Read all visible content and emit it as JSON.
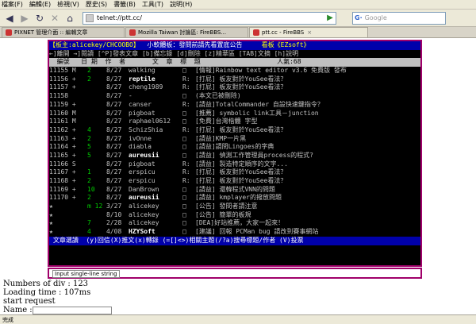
{
  "menubar": [
    "檔案(F)",
    "編輯(E)",
    "檢視(V)",
    "歷史(S)",
    "書籤(B)",
    "工具(T)",
    "說明(H)"
  ],
  "navbar": {
    "url": "telnet://ptt.cc/",
    "search_placeholder": "Google"
  },
  "tabs": [
    {
      "label": "PIXNET 管理介面 :: 編輯文章",
      "active": false
    },
    {
      "label": "Mozilla Taiwan 討論區: FireBBS...",
      "active": false
    },
    {
      "label": "ptt.cc - FireBBS",
      "active": true
    }
  ],
  "terminal": {
    "header1": {
      "left": "【板主:alicekey/CHCOOBO】",
      "mid": "小軟體板：發問前請先看置底公告",
      "right": "看板《EZsoft》"
    },
    "header2": "←]離開 →]閱讀 [^P]發表文章 [b]備忘錄 [d]刪除 [z]精華區 [TAB]文摘 [h]說明",
    "header3": "  編號   日 期  作  者       文  章  標  題                    人氣:68",
    "rows": [
      {
        "num": "11155 M",
        "mark": "2",
        "date": "8/27",
        "author": "walking",
        "bold": false,
        "tag": "□",
        "title": "[情報]Rainbow text editor v3.6 免費版 發布"
      },
      {
        "num": "11156 +",
        "mark": "2",
        "date": "8/27",
        "author": "reptile",
        "bold": true,
        "tag": "R:",
        "title": "[打屁] 板友對於YouSee看法？"
      },
      {
        "num": "11157 +",
        "mark": "",
        "date": "8/27",
        "author": "cheng1989",
        "bold": false,
        "tag": "R:",
        "title": "[打屁] 板友對於YouSee看法？"
      },
      {
        "num": "11158",
        "mark": "",
        "date": "8/27",
        "author": "-",
        "bold": false,
        "tag": "□",
        "title": "(本文已被刪除)"
      },
      {
        "num": "11159 +",
        "mark": "",
        "date": "8/27",
        "author": "canser",
        "bold": false,
        "tag": "R:",
        "title": "[請益]TotalCommander 自設快速鍵指令？"
      },
      {
        "num": "11160 M",
        "mark": "",
        "date": "8/27",
        "author": "pigboat",
        "bold": false,
        "tag": "□",
        "title": "[推薦] symbolic link工具－junction"
      },
      {
        "num": "11161 M",
        "mark": "",
        "date": "8/27",
        "author": "raphael0612",
        "bold": false,
        "tag": "□",
        "title": "[免費]台灣楷體 字型"
      },
      {
        "num": "11162 +",
        "mark": "4",
        "date": "8/27",
        "author": "SchizShia",
        "bold": false,
        "tag": "R:",
        "title": "[打屁] 板友對於YouSee看法？"
      },
      {
        "num": "11163 +",
        "mark": "2",
        "date": "8/27",
        "author": "ivOnne",
        "bold": false,
        "tag": "□",
        "title": "[請益]KMP一片黑"
      },
      {
        "num": "11164 +",
        "mark": "5",
        "date": "8/27",
        "author": "diabla",
        "bold": false,
        "tag": "□",
        "title": "[請益]請問Lingoes的字典"
      },
      {
        "num": "11165 +",
        "mark": "5",
        "date": "8/27",
        "author": "aureusii",
        "bold": true,
        "tag": "□",
        "title": "[請益] 偵測工作管理員process的程式?"
      },
      {
        "num": "11166 S",
        "mark": "",
        "date": "8/27",
        "author": "pigboat",
        "bold": false,
        "tag": "R:",
        "title": "[請益] 製造特定順序的文字..."
      },
      {
        "num": "11167 +",
        "mark": "1",
        "date": "8/27",
        "author": "erspicu",
        "bold": false,
        "tag": "R:",
        "title": "[打屁] 板友對於YouSee看法？"
      },
      {
        "num": "11168 +",
        "mark": "2",
        "date": "8/27",
        "author": "erspicu",
        "bold": false,
        "tag": "R:",
        "title": "[打屁] 板友對於YouSee看法？"
      },
      {
        "num": "11169 +",
        "mark": "10",
        "date": "8/27",
        "author": "DanBrown",
        "bold": false,
        "tag": "□",
        "title": "[請益] 還韓程式VNN的問題"
      },
      {
        "num": "11170 +",
        "mark": "2",
        "date": "8/27",
        "author": "aureusii",
        "bold": true,
        "tag": "□",
        "title": "[請益] kmplayer的撥放問題"
      },
      {
        "num": "★",
        "mark": "m 12",
        "date": "3/27",
        "author": "alicekey",
        "bold": false,
        "tag": "□",
        "title": "[公告] 發問者請注意"
      },
      {
        "num": "★",
        "mark": "",
        "date": "8/10",
        "author": "alicekey",
        "bold": false,
        "tag": "□",
        "title": "[公告] 簡單的板規"
      },
      {
        "num": "★",
        "mark": "7",
        "date": "2/28",
        "author": "alicekey",
        "bold": false,
        "tag": "□",
        "title": "[DEA]好站推薦，大家一起來！"
      },
      {
        "num": "★",
        "mark": "4",
        "date": "4/08",
        "author": "HZYSoft",
        "bold": true,
        "tag": "□",
        "title": "[建議] 回報 PCMan bug 請改到賽事網站"
      }
    ],
    "footer": " 文章選讀  (y)回信(X)推文(x)轉錄 (=[]<>)相關主題(/?a)搜尋標題/作者 (V)投票"
  },
  "input_hint": "Input single-line string",
  "debug": {
    "divs": "Numbers of div : 123",
    "loading": "Loading time : 107ms",
    "start": "start request",
    "name_label": "Name :"
  },
  "statusbar": "完成"
}
